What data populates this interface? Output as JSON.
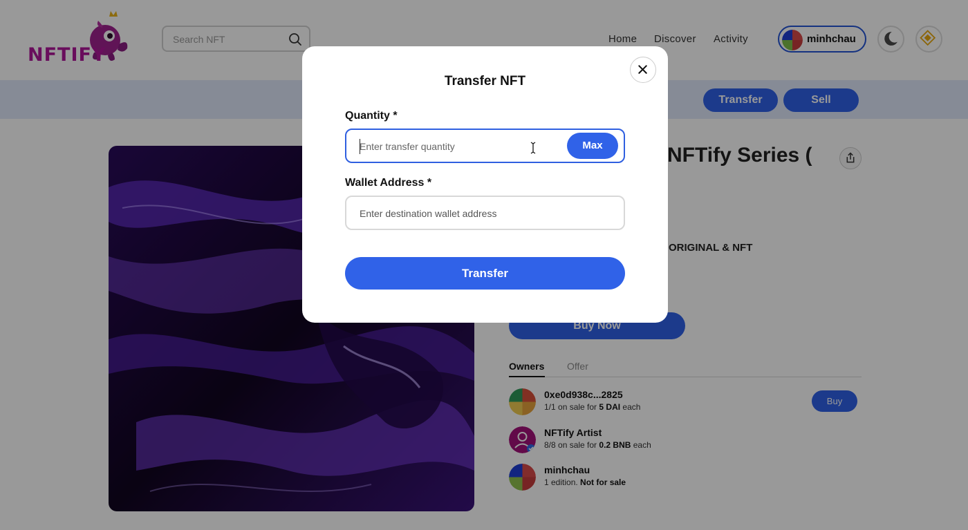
{
  "header": {
    "logo_text": "NFTIFY",
    "search": {
      "placeholder": "Search NFT",
      "value": ""
    },
    "nav": [
      {
        "label": "Home"
      },
      {
        "label": "Discover"
      },
      {
        "label": "Activity"
      }
    ],
    "user": {
      "name": "minhchau"
    },
    "icons": [
      "moon-icon",
      "binance-icon"
    ]
  },
  "action_bar": {
    "transfer_label": "Transfer",
    "sell_label": "Sell"
  },
  "nft": {
    "title": "NFTify Series (",
    "category": "ORIGINAL & NFT",
    "buy_now_label": "Buy Now"
  },
  "tabs": [
    {
      "label": "Owners",
      "active": true
    },
    {
      "label": "Offer",
      "active": false
    }
  ],
  "owners": [
    {
      "name": "0xe0d938c...2825",
      "prefix": "1/1 on sale for ",
      "price": "5 DAI",
      "suffix": " each",
      "action": "Buy"
    },
    {
      "name": "NFTify Artist",
      "prefix": "8/8 on sale for ",
      "price": "0.2 BNB",
      "suffix": " each",
      "verified": true
    },
    {
      "name": "minhchau",
      "prefix": "1 edition. ",
      "price": "Not for sale",
      "suffix": ""
    }
  ],
  "modal": {
    "title": "Transfer NFT",
    "quantity": {
      "label": "Quantity *",
      "placeholder": "Enter transfer quantity",
      "value": "",
      "max_label": "Max"
    },
    "wallet": {
      "label": "Wallet Address *",
      "placeholder": "Enter destination wallet address",
      "value": ""
    },
    "submit_label": "Transfer"
  },
  "colors": {
    "accent": "#3062e8",
    "action_bar_bg": "#dfe8fb",
    "logo": "#b0179a",
    "overlay": "rgba(0,0,0,0.40)"
  }
}
